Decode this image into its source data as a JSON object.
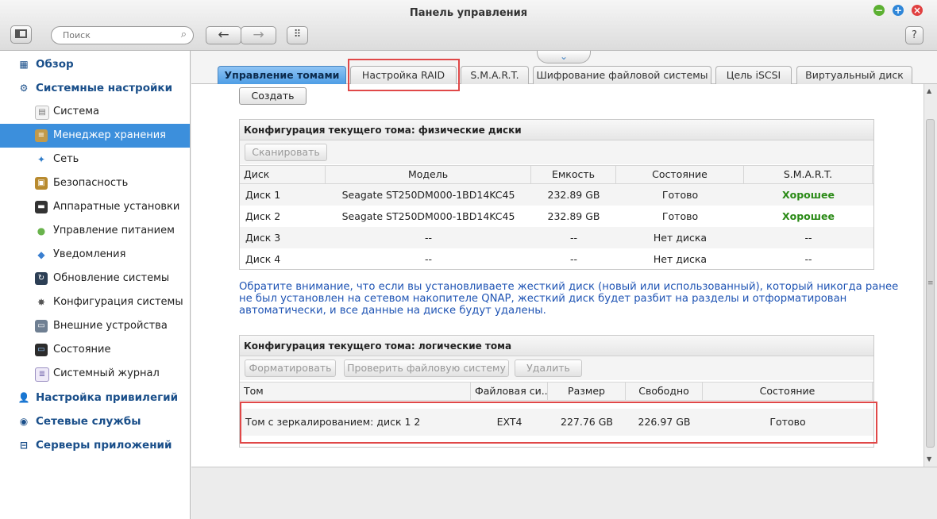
{
  "window": {
    "title": "Панель управления",
    "buttons": [
      "minimize",
      "maximize",
      "close"
    ]
  },
  "toolbar": {
    "search_placeholder": "Поиск",
    "help_label": "?"
  },
  "sidebar": {
    "items": [
      {
        "label": "Обзор",
        "level": 1,
        "icon": "overview-icon"
      },
      {
        "label": "Системные настройки",
        "level": 1,
        "icon": "gear-icon"
      },
      {
        "label": "Система",
        "level": 2,
        "icon": "system-icon"
      },
      {
        "label": "Менеджер хранения",
        "level": 2,
        "icon": "storage-icon",
        "active": true
      },
      {
        "label": "Сеть",
        "level": 2,
        "icon": "network-icon"
      },
      {
        "label": "Безопасность",
        "level": 2,
        "icon": "lock-icon"
      },
      {
        "label": "Аппаратные установки",
        "level": 2,
        "icon": "hardware-icon"
      },
      {
        "label": "Управление питанием",
        "level": 2,
        "icon": "bulb-icon"
      },
      {
        "label": "Уведомления",
        "level": 2,
        "icon": "notification-icon"
      },
      {
        "label": "Обновление системы",
        "level": 2,
        "icon": "update-icon"
      },
      {
        "label": "Конфигурация системы",
        "level": 2,
        "icon": "config-icon"
      },
      {
        "label": "Внешние устройства",
        "level": 2,
        "icon": "external-device-icon"
      },
      {
        "label": "Состояние",
        "level": 2,
        "icon": "monitor-icon"
      },
      {
        "label": "Системный журнал",
        "level": 2,
        "icon": "log-icon"
      },
      {
        "label": "Настройка привилегий",
        "level": 1,
        "icon": "user-icon"
      },
      {
        "label": "Сетевые службы",
        "level": 1,
        "icon": "network-services-icon"
      },
      {
        "label": "Серверы приложений",
        "level": 1,
        "icon": "app-server-icon"
      }
    ]
  },
  "tabs": [
    {
      "label": "Управление томами",
      "active": true
    },
    {
      "label": "Настройка RAID"
    },
    {
      "label": "S.M.A.R.T."
    },
    {
      "label": "Шифрование файловой системы"
    },
    {
      "label": "Цель iSCSI"
    },
    {
      "label": "Виртуальный диск"
    }
  ],
  "create_label": "Создать",
  "physical": {
    "title": "Конфигурация текущего тома: физические диски",
    "scan_label": "Сканировать",
    "columns": [
      "Диск",
      "Модель",
      "Емкость",
      "Состояние",
      "S.M.A.R.T."
    ],
    "rows": [
      [
        "Диск 1",
        "Seagate ST250DM000-1BD14KC45",
        "232.89 GB",
        "Готово",
        "Хорошее"
      ],
      [
        "Диск 2",
        "Seagate ST250DM000-1BD14KC45",
        "232.89 GB",
        "Готово",
        "Хорошее"
      ],
      [
        "Диск 3",
        "--",
        "--",
        "Нет диска",
        "--"
      ],
      [
        "Диск 4",
        "--",
        "--",
        "Нет диска",
        "--"
      ]
    ]
  },
  "notice_lines": [
    "Обратите внимание, что если вы установливаете жесткий диск (новый или использованный), который никогда ранее",
    "не был установлен на сетевом накопителе QNAP, жесткий диск будет разбит на разделы и отформатирован",
    "автоматически, и все данные на диске будут удалены."
  ],
  "logical": {
    "title": "Конфигурация текущего тома: логические тома",
    "buttons": [
      "Форматировать",
      "Проверить файловую систему",
      "Удалить"
    ],
    "columns": [
      "Том",
      "Файловая си...",
      "Размер",
      "Свободно",
      "Состояние"
    ],
    "rows": [
      [
        "Том с зеркалированием: диск 1 2",
        "EXT4",
        "227.76 GB",
        "226.97 GB",
        "Готово"
      ]
    ]
  },
  "colors": {
    "accent": "#3c8fdc",
    "good": "#2a8a16",
    "notice": "#1f54b4",
    "highlight": "#e04848"
  }
}
